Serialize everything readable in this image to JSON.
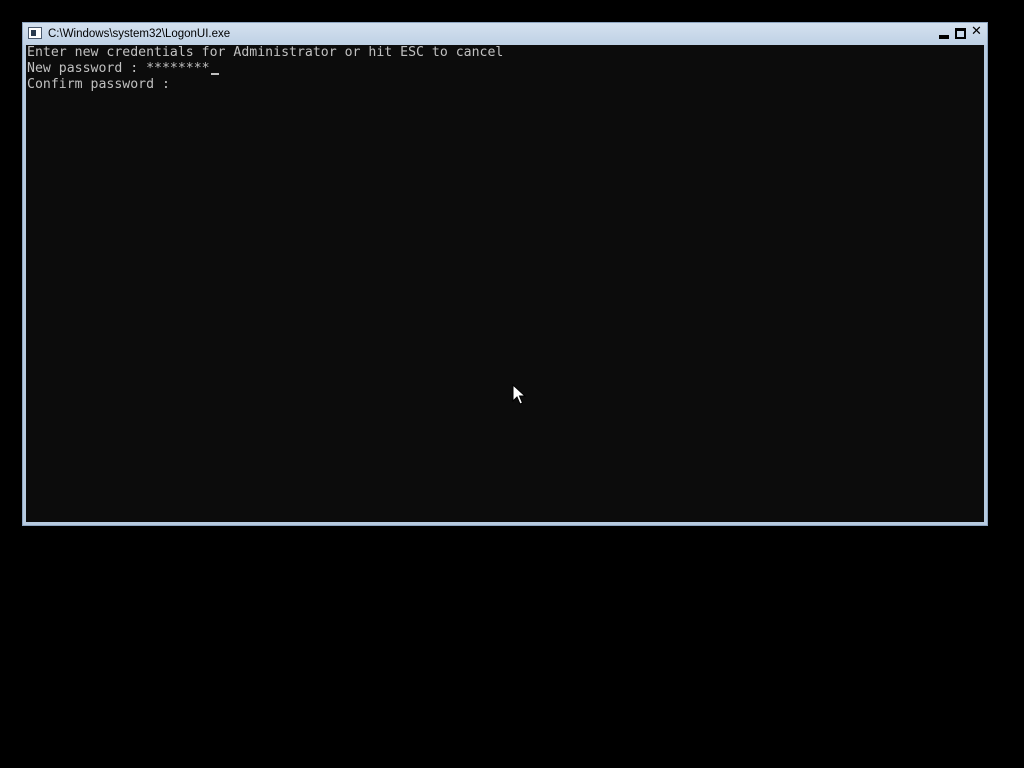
{
  "window": {
    "title": "C:\\Windows\\system32\\LogonUI.exe",
    "icon": "console-window-icon",
    "buttons": {
      "minimize": "minimize-icon",
      "maximize": "maximize-icon",
      "close": "close-icon"
    }
  },
  "console": {
    "prompt": "Enter new credentials for Administrator or hit ESC to cancel",
    "new_password_label": "New password : ",
    "new_password_value": "********",
    "confirm_password_label": "Confirm password : ",
    "confirm_password_value": ""
  },
  "colors": {
    "console_background": "#0c0c0c",
    "console_text": "#c0c0c0",
    "title_bar": "#c7d7ea",
    "desktop": "#000000"
  },
  "pointer": {
    "icon": "arrow-cursor-icon"
  }
}
